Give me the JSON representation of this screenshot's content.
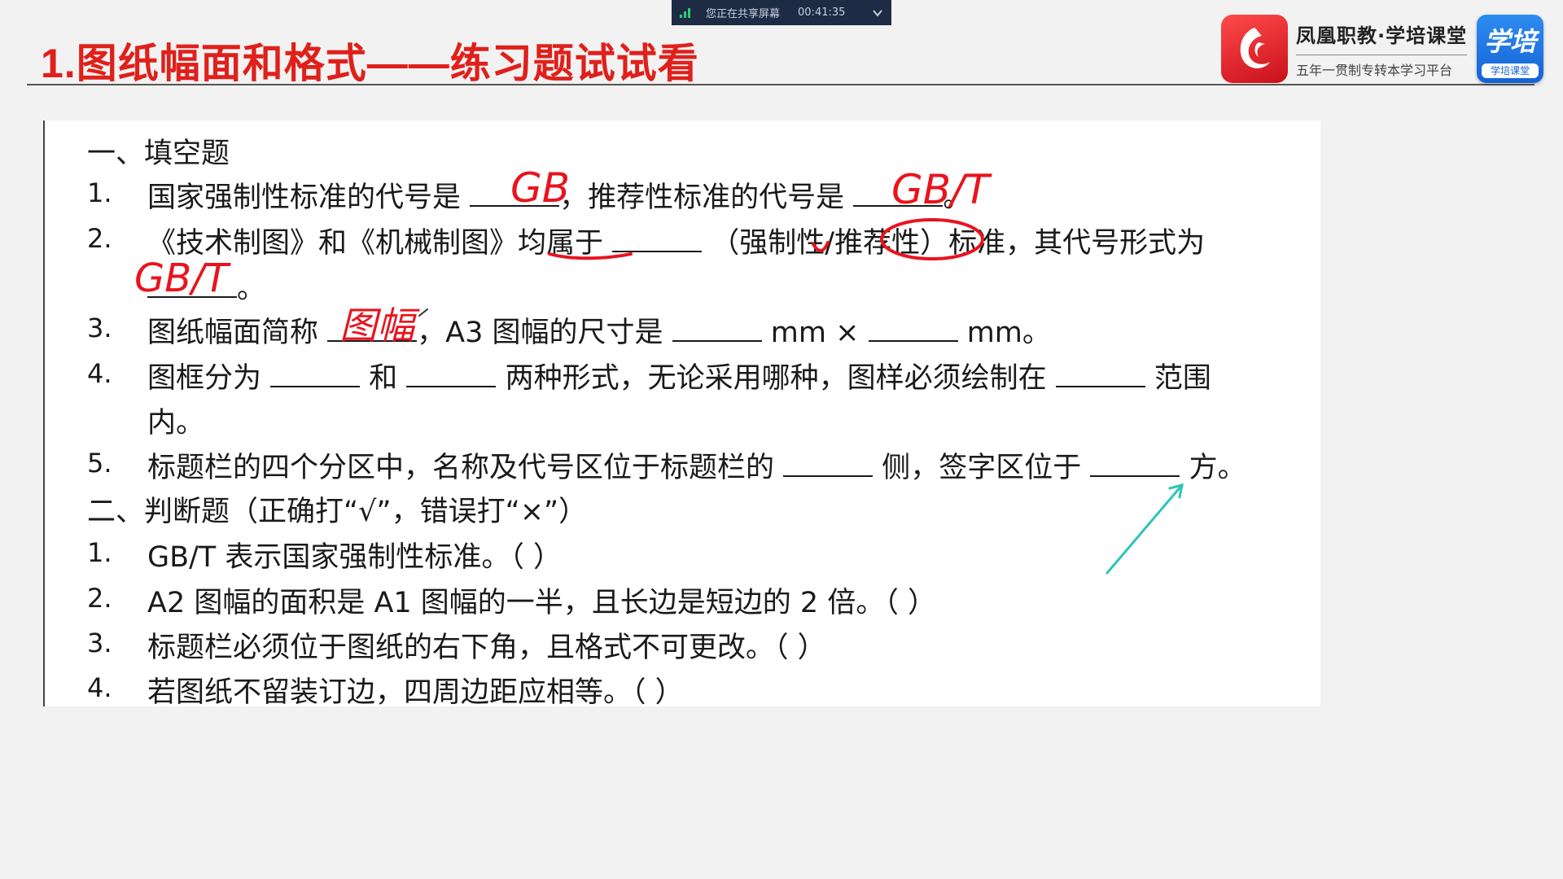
{
  "share_bar": {
    "status": "您正在共享屏幕",
    "time": "00:41:35"
  },
  "slide": {
    "title": "1.图纸幅面和格式——练习题试试看"
  },
  "brand": {
    "name": "凤凰职教·学培课堂",
    "subtitle": "五年一贯制专转本学习平台",
    "badge_text": "学培",
    "badge_sub": "学培课堂"
  },
  "content": {
    "section1": "一、填空题",
    "fill": [
      {
        "num": "1.",
        "text_a": "国家强制性标准的代号是",
        "text_b": "，推荐性标准的代号是",
        "text_c": "。"
      },
      {
        "num": "2.",
        "text_a": "《技术制图》和《机械制图》均属于",
        "text_b": "（强制性/推荐性）标准，其代号形式为",
        "text_c": "。"
      },
      {
        "num": "3.",
        "text_a": "图纸幅面简称",
        "text_b": "，A3 图幅的尺寸是",
        "text_c": "mm ×",
        "text_d": "mm。"
      },
      {
        "num": "4.",
        "text_a": "图框分为",
        "text_b": "和",
        "text_c": "两种形式，无论采用哪种，图样必须绘制在",
        "text_d": "范围",
        "text_e": "内。"
      },
      {
        "num": "5.",
        "text_a": "标题栏的四个分区中，名称及代号区位于标题栏的",
        "text_b": "侧，签字区位于",
        "text_c": "方。"
      }
    ],
    "section2": "二、判断题（正确打“√”，错误打“×”）",
    "judge": [
      {
        "num": "1.",
        "text": "GB/T 表示国家强制性标准。（    ）"
      },
      {
        "num": "2.",
        "text": "A2 图幅的面积是 A1 图幅的一半，且长边是短边的 2 倍。（    ）"
      },
      {
        "num": "3.",
        "text": "标题栏必须位于图纸的右下角，且格式不可更改。（    ）"
      },
      {
        "num": "4.",
        "text": "若图纸不留装订边，四周边距应相等。（    ）"
      }
    ],
    "annotations": {
      "ans1a": "GB",
      "ans1b": "GB/T",
      "ans2": "GB/T",
      "ans3": "图幅"
    }
  },
  "colors": {
    "title_red": "#e0201b",
    "ink_red": "#e8141e",
    "ink_cyan": "#2ec4b6"
  }
}
